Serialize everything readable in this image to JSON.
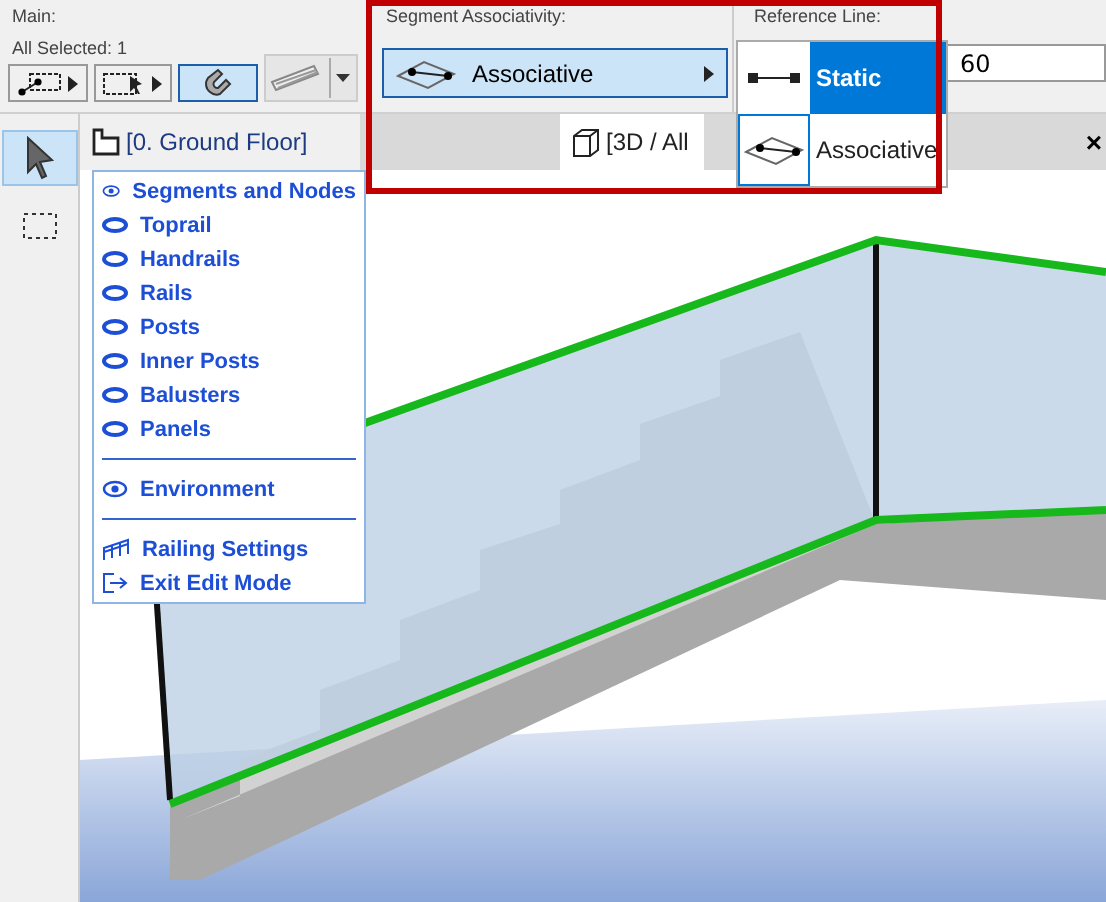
{
  "toolbar": {
    "main_label": "Main:",
    "selection_info": "All Selected: 1",
    "tools": [
      {
        "kind": "nodemarquee",
        "selected": false,
        "disabled": false
      },
      {
        "kind": "marqueearrow",
        "selected": false,
        "disabled": false
      },
      {
        "kind": "magnet",
        "selected": true,
        "disabled": false
      },
      {
        "kind": "plank",
        "selected": false,
        "disabled": true
      }
    ]
  },
  "segment_associativity": {
    "label": "Segment Associativity:",
    "value": "Associative"
  },
  "reference_line": {
    "label": "Reference Line:",
    "field_value": "60",
    "options": [
      {
        "label": "Static",
        "kind": "static",
        "selected": true
      },
      {
        "label": "Associative",
        "kind": "associative",
        "selected": false
      }
    ]
  },
  "tool_column": [
    {
      "kind": "arrow",
      "selected": true
    },
    {
      "kind": "marquee",
      "selected": false
    }
  ],
  "view_tabs": [
    {
      "label": "[0. Ground Floor]",
      "kind": "floorplan"
    },
    {
      "label": "[3D / All",
      "kind": "perspective"
    }
  ],
  "close_label": "×",
  "context_menu": {
    "groups": [
      [
        {
          "label": "Segments and Nodes",
          "kind": "shown"
        },
        {
          "label": "Toprail",
          "kind": "hidden"
        },
        {
          "label": "Handrails",
          "kind": "hidden"
        },
        {
          "label": "Rails",
          "kind": "hidden"
        },
        {
          "label": "Posts",
          "kind": "hidden"
        },
        {
          "label": "Inner Posts",
          "kind": "hidden"
        },
        {
          "label": "Balusters",
          "kind": "hidden"
        },
        {
          "label": "Panels",
          "kind": "hidden"
        }
      ],
      [
        {
          "label": "Environment",
          "kind": "shown"
        }
      ],
      [
        {
          "label": "Railing Settings",
          "kind": "settings"
        },
        {
          "label": "Exit Edit Mode",
          "kind": "exit"
        }
      ]
    ]
  }
}
